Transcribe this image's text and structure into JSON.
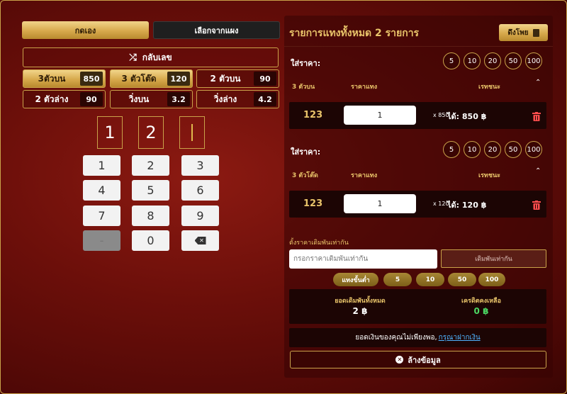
{
  "tabs": {
    "manual": "กดเอง",
    "from_panel": "เลือกจากแผง"
  },
  "shuffle_label": "กลับเลข",
  "bet_types": [
    {
      "label": "3ตัวบน",
      "rate": "850",
      "selected": true
    },
    {
      "label": "3 ตัวโต๊ด",
      "rate": "120",
      "selected": true
    },
    {
      "label": "2 ตัวบน",
      "rate": "90",
      "selected": false
    },
    {
      "label": "2 ตัวล่าง",
      "rate": "90",
      "selected": false
    },
    {
      "label": "วิ่งบน",
      "rate": "3.2",
      "selected": false
    },
    {
      "label": "วิ่งล่าง",
      "rate": "4.2",
      "selected": false
    }
  ],
  "digits": [
    "1",
    "2",
    ""
  ],
  "keypad": [
    "1",
    "2",
    "3",
    "4",
    "5",
    "6",
    "7",
    "8",
    "9",
    "-",
    "0",
    "backspace"
  ],
  "right": {
    "title": "รายการแทงทั้งหมด 2 รายการ",
    "pull_button": "ดึงโพย",
    "sections": [
      {
        "price_label": "ใส่ราคา:",
        "chips": [
          "5",
          "10",
          "20",
          "50",
          "100"
        ],
        "type": "3 ตัวบน",
        "col_price": "ราคาแทง",
        "col_win": "เรทชนะ",
        "number": "123",
        "amount": "1",
        "multiplier": "x 850",
        "win": "ได้: 850 ฿"
      },
      {
        "price_label": "ใส่ราคา:",
        "chips": [
          "5",
          "10",
          "20",
          "50",
          "100"
        ],
        "type": "3 ตัวโต๊ด",
        "col_price": "ราคาแทง",
        "col_win": "เรทชนะ",
        "number": "123",
        "amount": "1",
        "multiplier": "x 120",
        "win": "ได้: 120 ฿"
      }
    ],
    "same_price_label": "ตั้งราคาเดิมพันเท่ากัน",
    "same_price_placeholder": "กรอกราคาเดิมพันเท่ากัน",
    "same_price_button": "เดิมพันเท่ากัน",
    "quick_pills": [
      "แทงขั้นต่ำ",
      "5",
      "10",
      "50",
      "100"
    ],
    "total_label": "ยอดเดิมพันทั้งหมด",
    "total_value": "2 ฿",
    "credit_label": "เครดิตคงเหลือ",
    "credit_value": "0 ฿",
    "warning_text": "ยอดเงินของคุณไม่เพียงพอ,",
    "deposit_link": "กรุณาฝากเงิน",
    "clear_button": "ล้างข้อมูล"
  },
  "colors": {
    "accent": "#e9c46a",
    "credit": "#4cd964",
    "link": "#4fb3ff",
    "trash": "#ff4d4d"
  }
}
